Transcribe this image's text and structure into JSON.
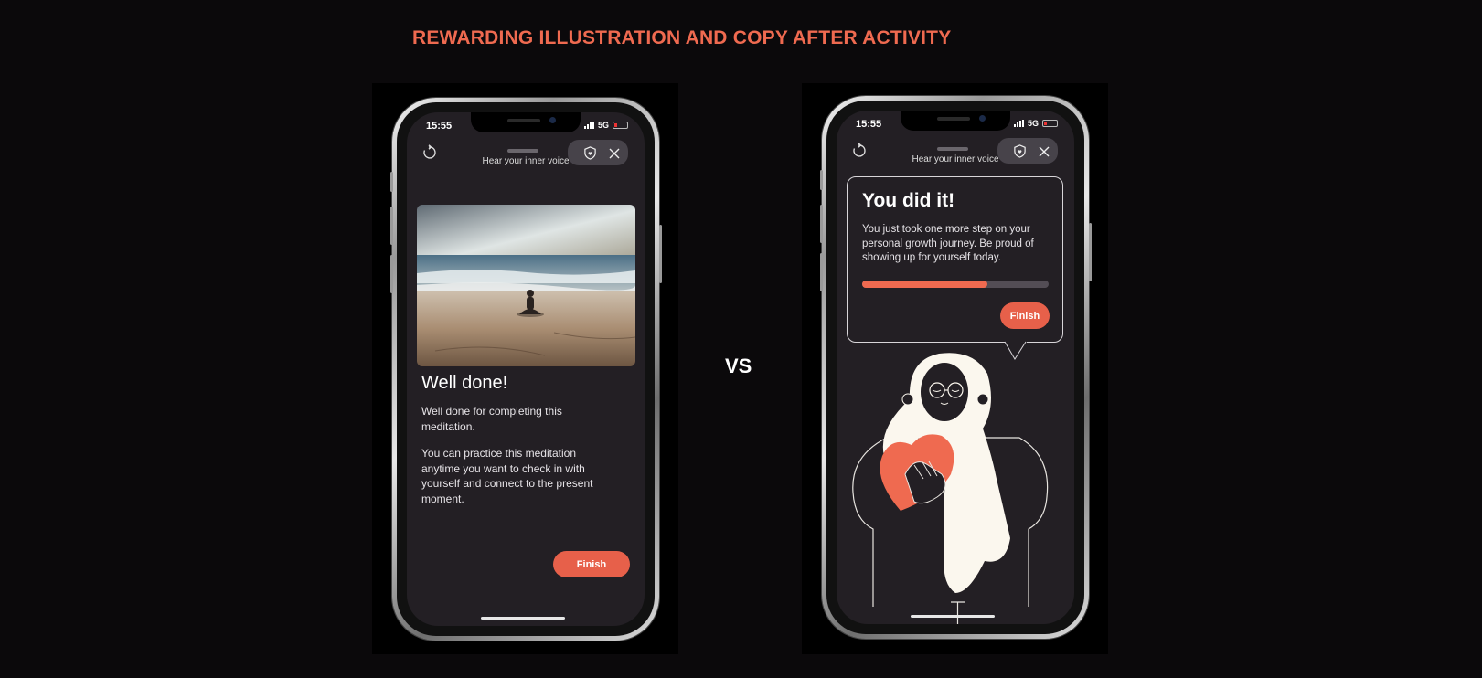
{
  "page": {
    "title": "REWARDING ILLUSTRATION AND COPY AFTER ACTIVITY",
    "separator": "VS"
  },
  "colors": {
    "accent": "#e7604a",
    "screen_bg": "#231f24",
    "title": "#ef6a50"
  },
  "left_phone": {
    "status": {
      "time": "15:55",
      "network": "5G"
    },
    "header_title": "Hear your inner voice",
    "icons": [
      "reload-icon",
      "shield-icon",
      "close-icon"
    ],
    "heading": "Well done!",
    "paragraph1": "Well done for completing this meditation.",
    "paragraph2": "You can practice this meditation anytime you want to check in with yourself and connect to the present moment.",
    "finish_label": "Finish"
  },
  "right_phone": {
    "status": {
      "time": "15:55",
      "network": "5G"
    },
    "header_title": "Hear your inner voice",
    "icons": [
      "reload-icon",
      "shield-icon",
      "close-icon"
    ],
    "heading": "You did it!",
    "paragraph": "You just took one more step on your personal growth journey. Be proud of showing up for yourself today.",
    "progress_percent": 67,
    "finish_label": "Finish"
  }
}
